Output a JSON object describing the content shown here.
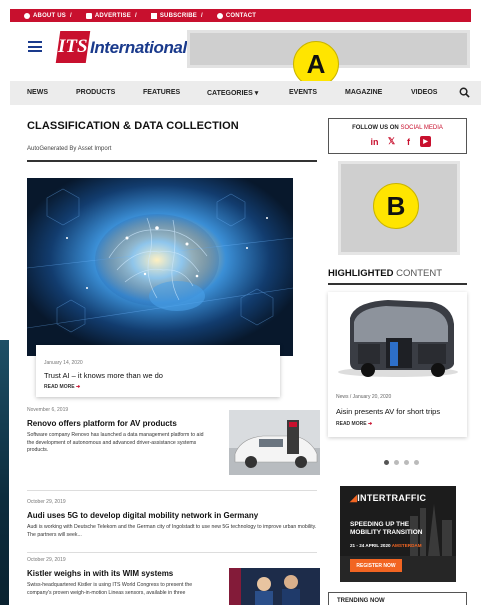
{
  "topbar": {
    "links": [
      {
        "label": "ABOUT US",
        "icon": "info-icon"
      },
      {
        "label": "ADVERTISE",
        "icon": "megaphone-icon"
      },
      {
        "label": "SUBSCRIBE",
        "icon": "newspaper-icon"
      },
      {
        "label": "CONTACT",
        "icon": "contact-icon"
      }
    ],
    "separator": "/"
  },
  "header": {
    "logo_mark": "ITS",
    "logo_text": "International",
    "banner_marker": "A"
  },
  "nav": {
    "items": [
      "NEWS",
      "PRODUCTS",
      "FEATURES",
      "CATEGORIES",
      "EVENTS",
      "MAGAZINE",
      "VIDEOS"
    ],
    "categories_caret": "▾"
  },
  "main": {
    "section_title": "CLASSIFICATION & DATA COLLECTION",
    "byline": "AutoGenerated By Asset Import",
    "hero": {
      "date": "January 14, 2020",
      "title": "Trust AI – it knows more than we do",
      "read_more": "READ MORE"
    },
    "articles": [
      {
        "date": "November 6, 2019",
        "title": "Renovo offers platform for AV products",
        "body": "Software company Renovo has launched a data management platform to aid the development of autonomous and advanced driver-assistance systems products."
      },
      {
        "date": "October 29, 2019",
        "title": "Audi uses 5G to develop digital mobility network in Germany",
        "body": "Audi is working with Deutsche Telekom and the German city of Ingolstadt to use new 5G technology to improve urban mobility. The partners will seek..."
      },
      {
        "date": "October 29, 2019",
        "title": "Kistler weighs in with its WIM systems",
        "body": "Swiss-headquartered Kistler is using ITS World Congress to present the company's proven weigh-in-motion Lineas sensors, available in three"
      }
    ]
  },
  "sidebar": {
    "follow": {
      "label_main": "FOLLOW US ON",
      "label_highlight": "SOCIAL MEDIA"
    },
    "social_icons": [
      "in",
      "𝕏",
      "f",
      "▶"
    ],
    "ad_marker": "B",
    "highlighted": {
      "title_bold": "HIGHLIGHTED",
      "title_light": "CONTENT",
      "meta": "News / January 20, 2020",
      "title": "Aisin presents AV for short trips",
      "read_more": "READ MORE",
      "dots": 4,
      "active_dot": 1
    },
    "intertraffic_ad": {
      "logo": "INTERTRAFFIC",
      "heading": "SPEEDING UP THE MOBILITY TRANSITION",
      "dates": "21 - 24 APRIL 2020",
      "city": "AMSTERDAM",
      "button": "REGISTER NOW"
    },
    "bottom_box_label": "TRENDING NOW"
  },
  "colors": {
    "brand_red": "#c8102e",
    "brand_blue": "#1a3a8c",
    "intertraffic_orange": "#f26522"
  }
}
